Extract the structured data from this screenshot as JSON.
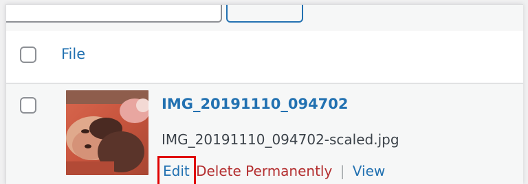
{
  "list_header": {
    "column_file_label": "File"
  },
  "media_item": {
    "title": "IMG_20191110_094702",
    "filename": "IMG_20191110_094702-scaled.jpg",
    "actions": {
      "edit_label": "Edit",
      "delete_label": "Delete Permanently",
      "view_label": "View",
      "separator": "|"
    }
  },
  "colors": {
    "link": "#2271b1",
    "delete": "#b32d2e",
    "highlight": "#e00000"
  }
}
